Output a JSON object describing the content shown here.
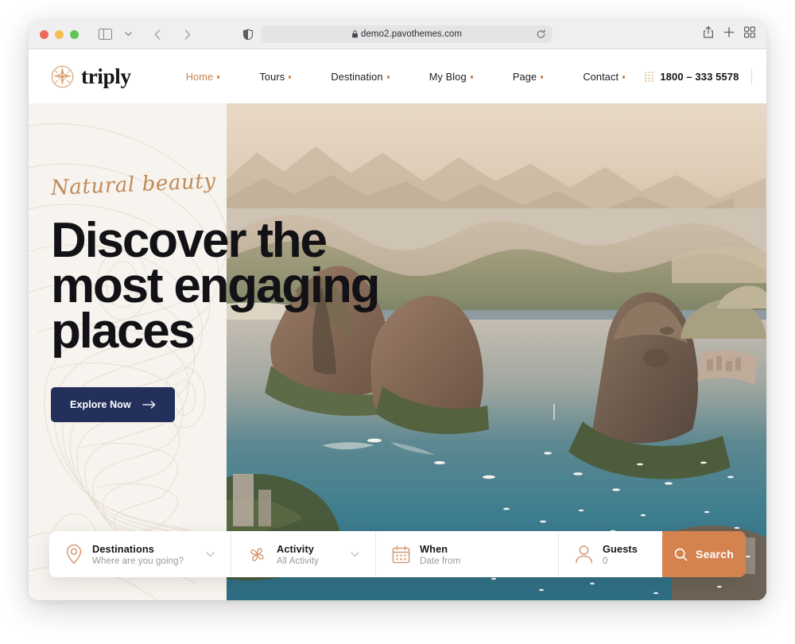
{
  "browser": {
    "url": "demo2.pavothemes.com",
    "lock_icon": "lock-icon",
    "privacy_icon": "shield-privacy-icon",
    "reload_icon": "reload-icon",
    "back_icon": "back-arrow-icon",
    "forward_icon": "forward-arrow-icon",
    "sidebar_icon": "sidebar-toggle-icon",
    "tab_dropdown_icon": "chevron-down-icon",
    "share_icon": "share-icon",
    "new_tab_icon": "plus-icon",
    "tab_overview_icon": "tab-overview-icon"
  },
  "header": {
    "logo_text": "triply",
    "logo_icon": "compass-star-icon",
    "nav": [
      {
        "label": "Home",
        "active": true
      },
      {
        "label": "Tours",
        "active": false
      },
      {
        "label": "Destination",
        "active": false
      },
      {
        "label": "My Blog",
        "active": false
      },
      {
        "label": "Page",
        "active": false
      },
      {
        "label": "Contact",
        "active": false
      }
    ],
    "phone": "1800 – 333 5578",
    "phone_grid_icon": "dot-grid-icon",
    "account_icon": "user-account-icon",
    "menu_icon": "hamburger-menu-icon"
  },
  "hero": {
    "eyebrow": "Natural beauty",
    "title_line1": "Discover the",
    "title_line2": "most engaging",
    "title_line3": "places",
    "cta_label": "Explore Now",
    "cta_arrow": "arrow-right-icon",
    "image_alt": "Aerial view of Rio de Janeiro bay with Sugarloaf Mountain"
  },
  "search": {
    "fields": [
      {
        "icon": "map-pin-icon",
        "title": "Destinations",
        "subtitle": "Where are you going?",
        "has_chevron": true
      },
      {
        "icon": "activity-pinwheel-icon",
        "title": "Activity",
        "subtitle": "All Activity",
        "has_chevron": true
      },
      {
        "icon": "calendar-icon",
        "title": "When",
        "subtitle": "Date from",
        "has_chevron": false
      },
      {
        "icon": "person-icon",
        "title": "Guests",
        "subtitle": "0",
        "has_chevron": false
      }
    ],
    "button_label": "Search",
    "button_icon": "search-magnifier-icon"
  },
  "colors": {
    "accent_orange": "#d4824e",
    "accent_copper": "#c9844f",
    "navy": "#23305c",
    "cream": "#f7f3ee",
    "ink": "#121216"
  }
}
